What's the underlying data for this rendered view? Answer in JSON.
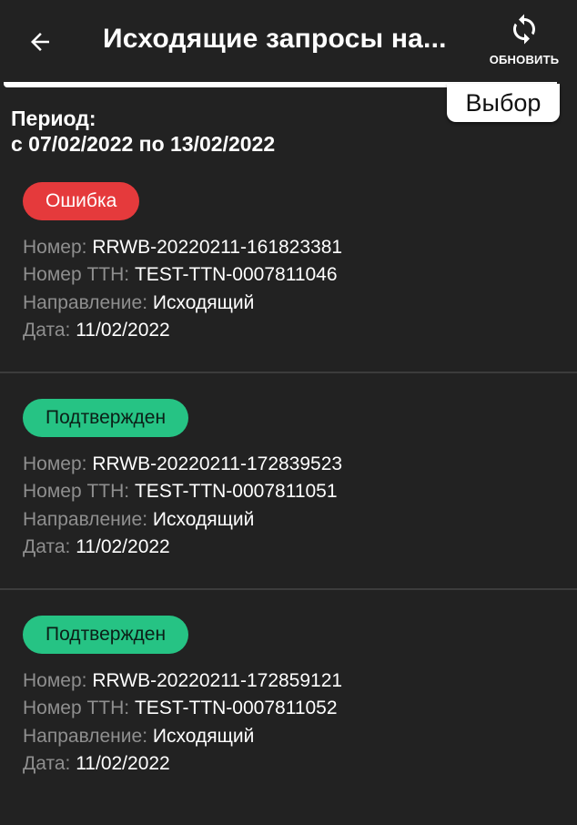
{
  "header": {
    "title": "Исходящие запросы на...",
    "refresh_label": "ОБНОВИТЬ"
  },
  "select_button": "Выбор",
  "period": {
    "label": "Период:",
    "range": "с 07/02/2022 по 13/02/2022"
  },
  "field_labels": {
    "number": "Номер:",
    "ttn": "Номер ТТН:",
    "direction": "Направление:",
    "date": "Дата:"
  },
  "colors": {
    "error_badge": "#e53a3c",
    "confirmed_badge": "#26c384",
    "background": "#222222"
  },
  "items": [
    {
      "status": "Ошибка",
      "number": "RRWB-20220211-161823381",
      "ttn": "TEST-TTN-0007811046",
      "direction": "Исходящий",
      "date": "11/02/2022"
    },
    {
      "status": "Подтвержден",
      "number": "RRWB-20220211-172839523",
      "ttn": "TEST-TTN-0007811051",
      "direction": "Исходящий",
      "date": "11/02/2022"
    },
    {
      "status": "Подтвержден",
      "number": "RRWB-20220211-172859121",
      "ttn": "TEST-TTN-0007811052",
      "direction": "Исходящий",
      "date": "11/02/2022"
    }
  ]
}
